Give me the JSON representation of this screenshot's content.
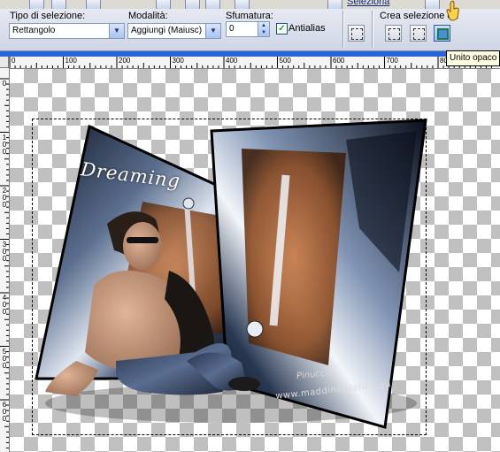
{
  "options_bar": {
    "selection_type": {
      "label": "Tipo di selezione:",
      "value": "Rettangolo"
    },
    "mode": {
      "label": "Modalità:",
      "value": "Aggiungi (Maiusc)"
    },
    "feather": {
      "label": "Sfumatura:",
      "value": "0"
    },
    "antialias": {
      "label": "Antialias",
      "checked": true
    },
    "create_selection": {
      "label": "Crea selezione da"
    }
  },
  "tooltip": {
    "text": "Unito opaco"
  },
  "toolbar_link": {
    "text": "Seleziona"
  },
  "ruler": {
    "h_labels": [
      "0",
      "100",
      "200",
      "300",
      "400",
      "500",
      "600",
      "700",
      "800"
    ],
    "v_labels": [
      "0",
      "100",
      "200",
      "300",
      "400",
      "500",
      "600"
    ]
  },
  "canvas": {
    "watermark_title": "Dreaming",
    "signature": "Pinuccia",
    "website": "www.maddinegrafica.eu"
  },
  "colors": {
    "accent": "#2a63d6",
    "selection_border": "#000000"
  }
}
